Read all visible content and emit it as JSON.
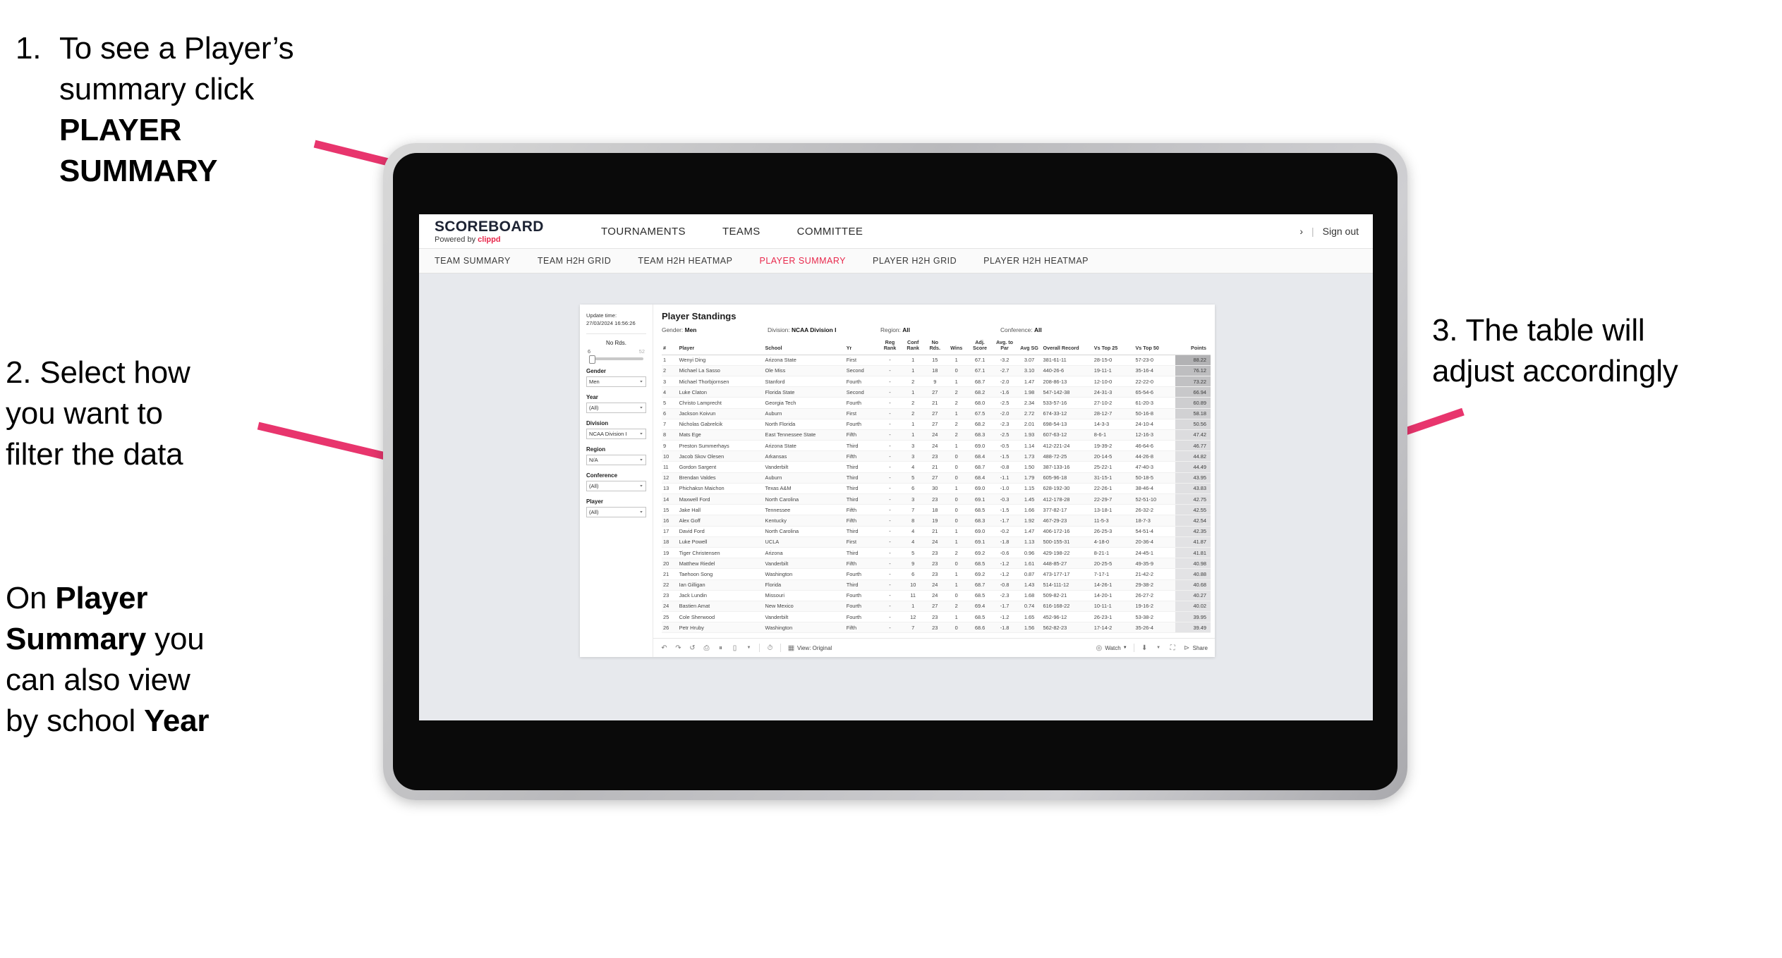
{
  "annotations": {
    "step1": {
      "number": "1.",
      "line1": "To see a Player’s",
      "line2_pre": "summary click ",
      "line2_bold": "PLAYER",
      "line3_bold": "SUMMARY"
    },
    "step2": {
      "line1": "2. Select how",
      "line2": "you want to",
      "line3": "filter the data"
    },
    "step2b": {
      "pre1": "On ",
      "bold1": "Player",
      "bold2": "Summary",
      "mid": " you",
      "line3": "can also view",
      "line4_pre": "by school ",
      "line4_bold": "Year"
    },
    "step3": {
      "line1": "3. The table will",
      "line2": "adjust accordingly"
    }
  },
  "app": {
    "brand": {
      "name": "SCOREBOARD",
      "powered_pre": "Powered by ",
      "powered_brand": "clippd"
    },
    "topnav": [
      "TOURNAMENTS",
      "TEAMS",
      "COMMITTEE"
    ],
    "header_right": {
      "chevron": "›",
      "separator": "|",
      "signout": "Sign out"
    },
    "subnav": {
      "items": [
        "TEAM SUMMARY",
        "TEAM H2H GRID",
        "TEAM H2H HEATMAP",
        "PLAYER SUMMARY",
        "PLAYER H2H GRID",
        "PLAYER H2H HEATMAP"
      ],
      "active": "PLAYER SUMMARY",
      "active_color": "#e8274b"
    }
  },
  "filters": {
    "update_label": "Update time:",
    "update_value": "27/03/2024 16:56:26",
    "slider": {
      "title": "No Rds.",
      "min": "6",
      "max": "52"
    },
    "groups": [
      {
        "label": "Gender",
        "value": "Men"
      },
      {
        "label": "Year",
        "value": "(All)"
      },
      {
        "label": "Division",
        "value": "NCAA Division I"
      },
      {
        "label": "Region",
        "value": "N/A"
      },
      {
        "label": "Conference",
        "value": "(All)"
      },
      {
        "label": "Player",
        "value": "(All)"
      }
    ]
  },
  "sheet": {
    "title": "Player Standings",
    "filter_summary": [
      {
        "label": "Gender: ",
        "value": "Men"
      },
      {
        "label": "Division: ",
        "value": "NCAA Division I"
      },
      {
        "label": "Region: ",
        "value": "All"
      },
      {
        "label": "Conference: ",
        "value": "All"
      }
    ],
    "columns": [
      "#",
      "Player",
      "School",
      "Yr",
      "Reg Rank",
      "Conf Rank",
      "No Rds.",
      "Wins",
      "Adj. Score",
      "Avg. to Par",
      "Avg SG",
      "Overall Record",
      "Vs Top 25",
      "Vs Top 50",
      "Points"
    ],
    "rows": [
      {
        "n": "1",
        "player": "Wenyi Ding",
        "school": "Arizona State",
        "yr": "First",
        "reg": "-",
        "conf": "1",
        "rds": "15",
        "wins": "1",
        "adj": "67.1",
        "par": "-3.2",
        "sg": "3.07",
        "rec": "381-61-11",
        "t25": "28-15-0",
        "t50": "57-23-0",
        "pts": "88.22"
      },
      {
        "n": "2",
        "player": "Michael La Sasso",
        "school": "Ole Miss",
        "yr": "Second",
        "reg": "-",
        "conf": "1",
        "rds": "18",
        "wins": "0",
        "adj": "67.1",
        "par": "-2.7",
        "sg": "3.10",
        "rec": "440-26-6",
        "t25": "19-11-1",
        "t50": "35-16-4",
        "pts": "76.12"
      },
      {
        "n": "3",
        "player": "Michael Thorbjornsen",
        "school": "Stanford",
        "yr": "Fourth",
        "reg": "-",
        "conf": "2",
        "rds": "9",
        "wins": "1",
        "adj": "68.7",
        "par": "-2.0",
        "sg": "1.47",
        "rec": "208-86-13",
        "t25": "12-10-0",
        "t50": "22-22-0",
        "pts": "73.22"
      },
      {
        "n": "4",
        "player": "Luke Claton",
        "school": "Florida State",
        "yr": "Second",
        "reg": "-",
        "conf": "1",
        "rds": "27",
        "wins": "2",
        "adj": "68.2",
        "par": "-1.6",
        "sg": "1.98",
        "rec": "547-142-38",
        "t25": "24-31-3",
        "t50": "65-54-6",
        "pts": "66.94"
      },
      {
        "n": "5",
        "player": "Christo Lamprecht",
        "school": "Georgia Tech",
        "yr": "Fourth",
        "reg": "-",
        "conf": "2",
        "rds": "21",
        "wins": "2",
        "adj": "68.0",
        "par": "-2.5",
        "sg": "2.34",
        "rec": "533-57-16",
        "t25": "27-10-2",
        "t50": "61-20-3",
        "pts": "60.89"
      },
      {
        "n": "6",
        "player": "Jackson Koivun",
        "school": "Auburn",
        "yr": "First",
        "reg": "-",
        "conf": "2",
        "rds": "27",
        "wins": "1",
        "adj": "67.5",
        "par": "-2.0",
        "sg": "2.72",
        "rec": "674-33-12",
        "t25": "28-12-7",
        "t50": "50-16-8",
        "pts": "58.18"
      },
      {
        "n": "7",
        "player": "Nicholas Gabrelcik",
        "school": "North Florida",
        "yr": "Fourth",
        "reg": "-",
        "conf": "1",
        "rds": "27",
        "wins": "2",
        "adj": "68.2",
        "par": "-2.3",
        "sg": "2.01",
        "rec": "698-54-13",
        "t25": "14-3-3",
        "t50": "24-10-4",
        "pts": "50.56"
      },
      {
        "n": "8",
        "player": "Mats Ege",
        "school": "East Tennessee State",
        "yr": "Fifth",
        "reg": "-",
        "conf": "1",
        "rds": "24",
        "wins": "2",
        "adj": "68.3",
        "par": "-2.5",
        "sg": "1.93",
        "rec": "607-63-12",
        "t25": "8-6-1",
        "t50": "12-16-3",
        "pts": "47.42"
      },
      {
        "n": "9",
        "player": "Preston Summerhays",
        "school": "Arizona State",
        "yr": "Third",
        "reg": "-",
        "conf": "3",
        "rds": "24",
        "wins": "1",
        "adj": "69.0",
        "par": "-0.5",
        "sg": "1.14",
        "rec": "412-221-24",
        "t25": "19-39-2",
        "t50": "46-64-6",
        "pts": "46.77"
      },
      {
        "n": "10",
        "player": "Jacob Skov Olesen",
        "school": "Arkansas",
        "yr": "Fifth",
        "reg": "-",
        "conf": "3",
        "rds": "23",
        "wins": "0",
        "adj": "68.4",
        "par": "-1.5",
        "sg": "1.73",
        "rec": "488-72-25",
        "t25": "20-14-5",
        "t50": "44-26-8",
        "pts": "44.82"
      },
      {
        "n": "11",
        "player": "Gordon Sargent",
        "school": "Vanderbilt",
        "yr": "Third",
        "reg": "-",
        "conf": "4",
        "rds": "21",
        "wins": "0",
        "adj": "68.7",
        "par": "-0.8",
        "sg": "1.50",
        "rec": "387-133-16",
        "t25": "25-22-1",
        "t50": "47-40-3",
        "pts": "44.49"
      },
      {
        "n": "12",
        "player": "Brendan Valdes",
        "school": "Auburn",
        "yr": "Third",
        "reg": "-",
        "conf": "5",
        "rds": "27",
        "wins": "0",
        "adj": "68.4",
        "par": "-1.1",
        "sg": "1.79",
        "rec": "605-96-18",
        "t25": "31-15-1",
        "t50": "50-18-5",
        "pts": "43.95"
      },
      {
        "n": "13",
        "player": "Phichaksn Maichon",
        "school": "Texas A&M",
        "yr": "Third",
        "reg": "-",
        "conf": "6",
        "rds": "30",
        "wins": "1",
        "adj": "69.0",
        "par": "-1.0",
        "sg": "1.15",
        "rec": "628-192-30",
        "t25": "22-26-1",
        "t50": "38-46-4",
        "pts": "43.83"
      },
      {
        "n": "14",
        "player": "Maxwell Ford",
        "school": "North Carolina",
        "yr": "Third",
        "reg": "-",
        "conf": "3",
        "rds": "23",
        "wins": "0",
        "adj": "69.1",
        "par": "-0.3",
        "sg": "1.45",
        "rec": "412-178-28",
        "t25": "22-29-7",
        "t50": "52-51-10",
        "pts": "42.75"
      },
      {
        "n": "15",
        "player": "Jake Hall",
        "school": "Tennessee",
        "yr": "Fifth",
        "reg": "-",
        "conf": "7",
        "rds": "18",
        "wins": "0",
        "adj": "68.5",
        "par": "-1.5",
        "sg": "1.66",
        "rec": "377-82-17",
        "t25": "13-18-1",
        "t50": "26-32-2",
        "pts": "42.55"
      },
      {
        "n": "16",
        "player": "Alex Goff",
        "school": "Kentucky",
        "yr": "Fifth",
        "reg": "-",
        "conf": "8",
        "rds": "19",
        "wins": "0",
        "adj": "68.3",
        "par": "-1.7",
        "sg": "1.92",
        "rec": "467-29-23",
        "t25": "11-5-3",
        "t50": "18-7-3",
        "pts": "42.54"
      },
      {
        "n": "17",
        "player": "David Ford",
        "school": "North Carolina",
        "yr": "Third",
        "reg": "-",
        "conf": "4",
        "rds": "21",
        "wins": "1",
        "adj": "69.0",
        "par": "-0.2",
        "sg": "1.47",
        "rec": "406-172-16",
        "t25": "26-25-3",
        "t50": "54-51-4",
        "pts": "42.35"
      },
      {
        "n": "18",
        "player": "Luke Powell",
        "school": "UCLA",
        "yr": "First",
        "reg": "-",
        "conf": "4",
        "rds": "24",
        "wins": "1",
        "adj": "69.1",
        "par": "-1.8",
        "sg": "1.13",
        "rec": "500-155-31",
        "t25": "4-18-0",
        "t50": "20-36-4",
        "pts": "41.87"
      },
      {
        "n": "19",
        "player": "Tiger Christensen",
        "school": "Arizona",
        "yr": "Third",
        "reg": "-",
        "conf": "5",
        "rds": "23",
        "wins": "2",
        "adj": "69.2",
        "par": "-0.6",
        "sg": "0.96",
        "rec": "429-198-22",
        "t25": "8-21-1",
        "t50": "24-45-1",
        "pts": "41.81"
      },
      {
        "n": "20",
        "player": "Matthew Riedel",
        "school": "Vanderbilt",
        "yr": "Fifth",
        "reg": "-",
        "conf": "9",
        "rds": "23",
        "wins": "0",
        "adj": "68.5",
        "par": "-1.2",
        "sg": "1.61",
        "rec": "448-85-27",
        "t25": "20-25-5",
        "t50": "49-35-9",
        "pts": "40.98"
      },
      {
        "n": "21",
        "player": "Taehoon Song",
        "school": "Washington",
        "yr": "Fourth",
        "reg": "-",
        "conf": "6",
        "rds": "23",
        "wins": "1",
        "adj": "69.2",
        "par": "-1.2",
        "sg": "0.87",
        "rec": "473-177-17",
        "t25": "7-17-1",
        "t50": "21-42-2",
        "pts": "40.88"
      },
      {
        "n": "22",
        "player": "Ian Gilligan",
        "school": "Florida",
        "yr": "Third",
        "reg": "-",
        "conf": "10",
        "rds": "24",
        "wins": "1",
        "adj": "68.7",
        "par": "-0.8",
        "sg": "1.43",
        "rec": "514-111-12",
        "t25": "14-26-1",
        "t50": "29-38-2",
        "pts": "40.68"
      },
      {
        "n": "23",
        "player": "Jack Lundin",
        "school": "Missouri",
        "yr": "Fourth",
        "reg": "-",
        "conf": "11",
        "rds": "24",
        "wins": "0",
        "adj": "68.5",
        "par": "-2.3",
        "sg": "1.68",
        "rec": "509-82-21",
        "t25": "14-20-1",
        "t50": "26-27-2",
        "pts": "40.27"
      },
      {
        "n": "24",
        "player": "Bastien Amat",
        "school": "New Mexico",
        "yr": "Fourth",
        "reg": "-",
        "conf": "1",
        "rds": "27",
        "wins": "2",
        "adj": "69.4",
        "par": "-1.7",
        "sg": "0.74",
        "rec": "616-168-22",
        "t25": "10-11-1",
        "t50": "19-16-2",
        "pts": "40.02"
      },
      {
        "n": "25",
        "player": "Cole Sherwood",
        "school": "Vanderbilt",
        "yr": "Fourth",
        "reg": "-",
        "conf": "12",
        "rds": "23",
        "wins": "1",
        "adj": "68.5",
        "par": "-1.2",
        "sg": "1.65",
        "rec": "452-96-12",
        "t25": "26-23-1",
        "t50": "53-38-2",
        "pts": "39.95"
      },
      {
        "n": "26",
        "player": "Petr Hruby",
        "school": "Washington",
        "yr": "Fifth",
        "reg": "-",
        "conf": "7",
        "rds": "23",
        "wins": "0",
        "adj": "68.6",
        "par": "-1.8",
        "sg": "1.56",
        "rec": "562-82-23",
        "t25": "17-14-2",
        "t50": "35-26-4",
        "pts": "39.49"
      }
    ]
  },
  "toolbar": {
    "view_label": "View: Original",
    "watch_label": "Watch",
    "share_label": "Share"
  }
}
